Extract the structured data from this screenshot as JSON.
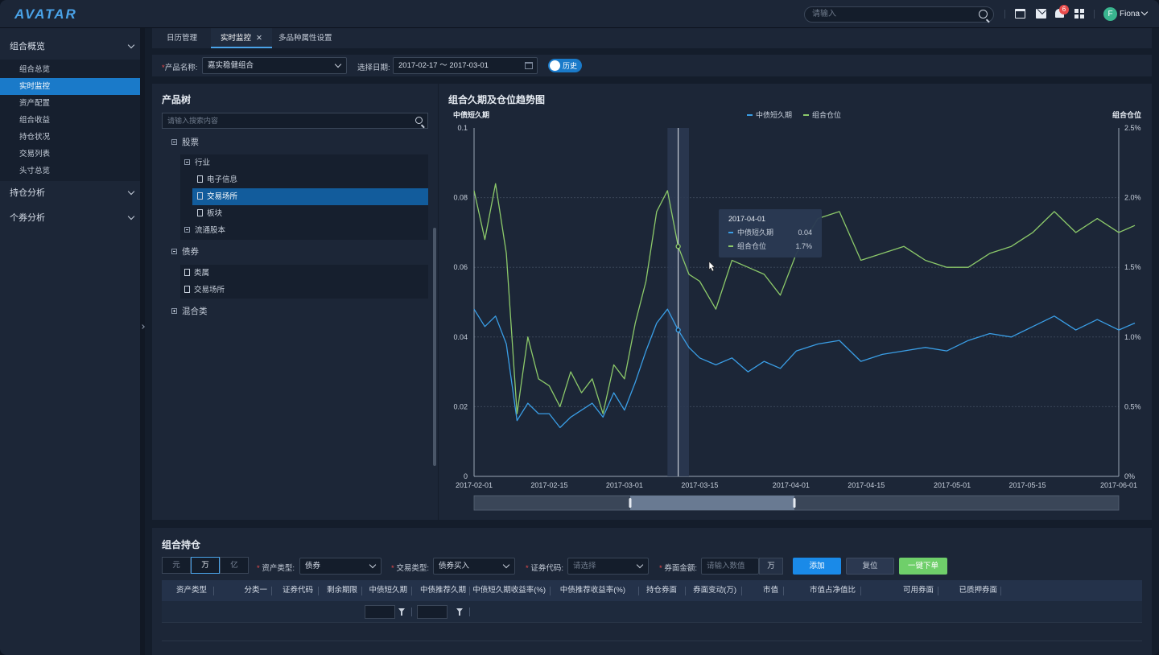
{
  "app": {
    "logo": "AVATAR",
    "search_placeholder": "请输入",
    "notification_count": "6",
    "user_initial": "F",
    "user_name": "Fiona"
  },
  "sidebar": {
    "groups": [
      {
        "label": "组合概览",
        "items": [
          "组合总览",
          "实时监控",
          "资产配置",
          "组合收益",
          "持仓状况",
          "交易列表",
          "头寸总览"
        ],
        "active_item": "实时监控"
      },
      {
        "label": "持仓分析"
      },
      {
        "label": "个券分析"
      }
    ]
  },
  "tabs": [
    {
      "label": "日历管理",
      "active": false
    },
    {
      "label": "实时监控",
      "active": true,
      "closable": true,
      "close_glyph": "✕"
    },
    {
      "label": "多品种属性设置",
      "active": false
    }
  ],
  "filter": {
    "required_mark": "*",
    "product_label": "产品名称:",
    "product_value": "嘉实稳健组合",
    "date_label": "选择日期:",
    "date_value": "2017-02-17  ～ 2017-03-01",
    "history_toggle_label": "历史",
    "history_on": true
  },
  "tree": {
    "title": "产品树",
    "search_placeholder": "请输入搜索内容",
    "nodes": {
      "stock": "股票",
      "industry": "行业",
      "electronic": "电子信息",
      "exchange": "交易场所",
      "sector": "板块",
      "float_shares": "流通股本",
      "bond": "债券",
      "category": "类属",
      "bond_exchange": "交易场所",
      "mixed": "混合类"
    },
    "selected": "交易场所"
  },
  "chart_panel": {
    "title": "组合久期及仓位趋势图"
  },
  "chart_data": {
    "type": "line",
    "title": "组合久期及仓位趋势图",
    "ylabel_left": "中债短久期",
    "ylabel_right": "组合仓位",
    "legend_placement": "top-center",
    "ylim_left": [
      0,
      0.1
    ],
    "yticks_left": [
      "0",
      "0.02",
      "0.04",
      "0.06",
      "0.08",
      "0.1"
    ],
    "ylim_right": [
      0,
      2.5
    ],
    "yticks_right": [
      "0%",
      "0.5%",
      "1.0%",
      "1.5%",
      "2.0%",
      "2.5%"
    ],
    "xticks": [
      "2017-02-01",
      "2017-02-15",
      "2017-03-01",
      "2017-03-15",
      "2017-04-01",
      "2017-04-15",
      "2017-05-01",
      "2017-05-15",
      "2017-06-01"
    ],
    "series": [
      {
        "name": "中债短久期",
        "axis": "left",
        "color": "#3a9ee6",
        "x": [
          "2017-02-01",
          "2017-02-03",
          "2017-02-05",
          "2017-02-07",
          "2017-02-09",
          "2017-02-11",
          "2017-02-13",
          "2017-02-15",
          "2017-02-17",
          "2017-02-19",
          "2017-02-21",
          "2017-02-23",
          "2017-02-25",
          "2017-02-27",
          "2017-03-01",
          "2017-03-03",
          "2017-03-05",
          "2017-03-07",
          "2017-03-09",
          "2017-03-11",
          "2017-03-13",
          "2017-03-15",
          "2017-03-18",
          "2017-03-21",
          "2017-03-24",
          "2017-03-27",
          "2017-03-30",
          "2017-04-02",
          "2017-04-06",
          "2017-04-10",
          "2017-04-14",
          "2017-04-18",
          "2017-04-22",
          "2017-04-26",
          "2017-04-30",
          "2017-05-04",
          "2017-05-08",
          "2017-05-12",
          "2017-05-16",
          "2017-05-20",
          "2017-05-24",
          "2017-05-28",
          "2017-06-01",
          "2017-06-04"
        ],
        "values": [
          0.048,
          0.043,
          0.046,
          0.038,
          0.016,
          0.021,
          0.018,
          0.018,
          0.014,
          0.017,
          0.019,
          0.021,
          0.017,
          0.024,
          0.019,
          0.027,
          0.036,
          0.044,
          0.048,
          0.042,
          0.037,
          0.034,
          0.032,
          0.034,
          0.03,
          0.033,
          0.031,
          0.036,
          0.038,
          0.039,
          0.033,
          0.035,
          0.036,
          0.037,
          0.036,
          0.039,
          0.041,
          0.04,
          0.043,
          0.046,
          0.042,
          0.045,
          0.042,
          0.044
        ]
      },
      {
        "name": "组合仓位",
        "axis": "right",
        "color": "#8cc96a",
        "x": [
          "2017-02-01",
          "2017-02-03",
          "2017-02-05",
          "2017-02-07",
          "2017-02-09",
          "2017-02-11",
          "2017-02-13",
          "2017-02-15",
          "2017-02-17",
          "2017-02-19",
          "2017-02-21",
          "2017-02-23",
          "2017-02-25",
          "2017-02-27",
          "2017-03-01",
          "2017-03-03",
          "2017-03-05",
          "2017-03-07",
          "2017-03-09",
          "2017-03-11",
          "2017-03-13",
          "2017-03-15",
          "2017-03-18",
          "2017-03-21",
          "2017-03-24",
          "2017-03-27",
          "2017-03-30",
          "2017-04-02",
          "2017-04-06",
          "2017-04-10",
          "2017-04-14",
          "2017-04-18",
          "2017-04-22",
          "2017-04-26",
          "2017-04-30",
          "2017-05-04",
          "2017-05-08",
          "2017-05-12",
          "2017-05-16",
          "2017-05-20",
          "2017-05-24",
          "2017-05-28",
          "2017-06-01",
          "2017-06-04"
        ],
        "values": [
          2.05,
          1.7,
          2.1,
          1.6,
          0.45,
          1.0,
          0.7,
          0.65,
          0.5,
          0.75,
          0.6,
          0.7,
          0.45,
          0.8,
          0.7,
          1.1,
          1.4,
          1.9,
          2.05,
          1.65,
          1.45,
          1.4,
          1.2,
          1.55,
          1.5,
          1.45,
          1.3,
          1.6,
          1.85,
          1.9,
          1.55,
          1.6,
          1.65,
          1.55,
          1.5,
          1.5,
          1.6,
          1.65,
          1.75,
          1.9,
          1.75,
          1.85,
          1.75,
          1.8
        ]
      }
    ],
    "highlight_band": [
      "2017-03-09",
      "2017-03-13"
    ],
    "crosshair_x": "2017-03-11",
    "tooltip": {
      "date": "2017-04-01",
      "rows": [
        {
          "name": "中债短久期",
          "value": "0.04"
        },
        {
          "name": "组合仓位",
          "value": "1.7%"
        }
      ]
    },
    "grid": true
  },
  "holdings": {
    "title": "组合持仓",
    "units": [
      "元",
      "万",
      "亿"
    ],
    "active_unit": "万",
    "required_mark": "*",
    "asset_type_label": "资产类型:",
    "asset_type_value": "债券",
    "trade_type_label": "交易类型:",
    "trade_type_value": "债券买入",
    "security_code_label": "证券代码:",
    "security_code_placeholder": "请选择",
    "face_amount_label": "券面金额:",
    "face_amount_placeholder": "请输入数值",
    "face_amount_unit": "万",
    "add_label": "添加",
    "reset_label": "复位",
    "order_label": "一键下单",
    "columns": [
      "资产类型",
      "分类一",
      "证券代码",
      "剩余期限",
      "中债短久期",
      "中债推荐久期",
      "中债短久期收益率(%)",
      "中债推荐收益率(%)",
      "持仓券面",
      "券面变动(万)",
      "市值",
      "市值占净值比",
      "可用券面",
      "已质押券面"
    ]
  }
}
